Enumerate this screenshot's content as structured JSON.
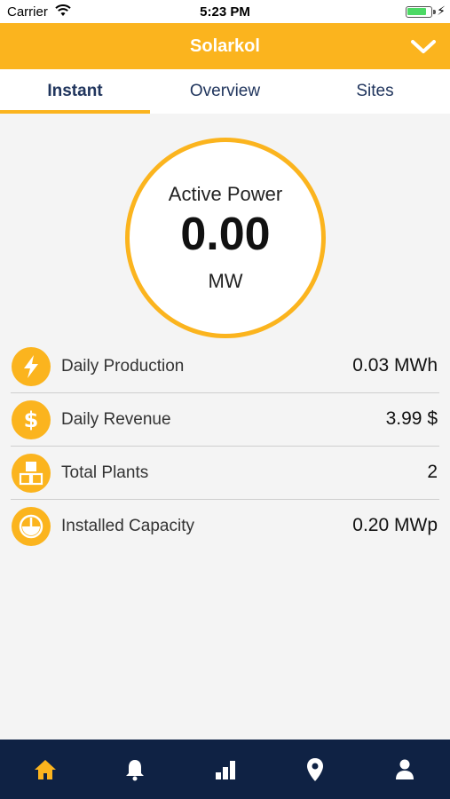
{
  "status_bar": {
    "carrier": "Carrier",
    "time": "5:23 PM",
    "battery_level": 0.85,
    "charging_symbol": "⚡"
  },
  "header": {
    "title": "Solarkol",
    "menu_icon": "chevron-down-icon"
  },
  "tabs": [
    {
      "label": "Instant",
      "active": true
    },
    {
      "label": "Overview",
      "active": false
    },
    {
      "label": "Sites",
      "active": false
    }
  ],
  "gauge": {
    "label": "Active Power",
    "value": "0.00",
    "unit": "MW"
  },
  "stats": [
    {
      "icon": "lightning-icon",
      "label": "Daily Production",
      "value": "0.03 MWh"
    },
    {
      "icon": "dollar-icon",
      "label": "Daily Revenue",
      "value": "3.99 $"
    },
    {
      "icon": "plants-icon",
      "label": "Total Plants",
      "value": "2"
    },
    {
      "icon": "capacity-icon",
      "label": "Installed Capacity",
      "value": "0.20 MWp"
    }
  ],
  "bottom_nav": [
    {
      "icon": "home-icon",
      "active": true
    },
    {
      "icon": "bell-icon",
      "active": false
    },
    {
      "icon": "bar-chart-icon",
      "active": false
    },
    {
      "icon": "location-pin-icon",
      "active": false
    },
    {
      "icon": "user-icon",
      "active": false
    }
  ],
  "colors": {
    "accent": "#fbb41e",
    "nav_background": "#0f2244",
    "tab_text": "#20355d",
    "nav_active": "#fbb41e",
    "nav_inactive": "#ffffff"
  }
}
